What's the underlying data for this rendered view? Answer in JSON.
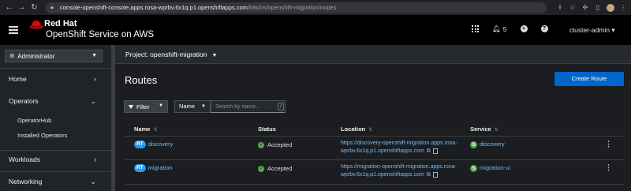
{
  "browser": {
    "url_host": "console-openshift-console.apps.rosa-wprbv.6x1q.p1.openshiftapps.com",
    "url_path": "/k8s/ns/openshift-migration/routes"
  },
  "masthead": {
    "brand_line1": "Red Hat",
    "brand_line2": "OpenShift Service on AWS",
    "notification_count": "5",
    "user": "cluster-admin"
  },
  "sidebar": {
    "perspective": "Administrator",
    "groups": [
      {
        "label": "Home"
      },
      {
        "label": "Operators"
      },
      {
        "label": "Workloads"
      },
      {
        "label": "Networking"
      }
    ],
    "operator_items": [
      "OperatorHub",
      "Installed Operators"
    ]
  },
  "project_bar": {
    "label": "Project: openshift-migration"
  },
  "page": {
    "title": "Routes",
    "create_button": "Create Route"
  },
  "toolbar": {
    "filter_label": "Filter",
    "name_dropdown": "Name",
    "search_placeholder": "Search by name...",
    "search_shortcut": "/"
  },
  "table": {
    "columns": [
      "Name",
      "Status",
      "Location",
      "Service"
    ],
    "rows": [
      {
        "badge": "RT",
        "name": "discovery",
        "status": "Accepted",
        "location_line1": "https://discovery-openshift-migration.apps.rosa-",
        "location_line2": "wprbv.6x1q.p1.openshiftapps.com",
        "service_badge": "S",
        "service": "discovery"
      },
      {
        "badge": "RT",
        "name": "migration",
        "status": "Accepted",
        "location_line1": "https://migration-openshift-migration.apps.rosa-",
        "location_line2": "wprbv.6x1q.p1.openshiftapps.com",
        "service_badge": "S",
        "service": "migration-ui"
      }
    ]
  },
  "colors": {
    "accent_blue": "#0066cc",
    "link": "#73bcf7",
    "route_badge": "#2b9af3",
    "success": "#5ba352"
  }
}
